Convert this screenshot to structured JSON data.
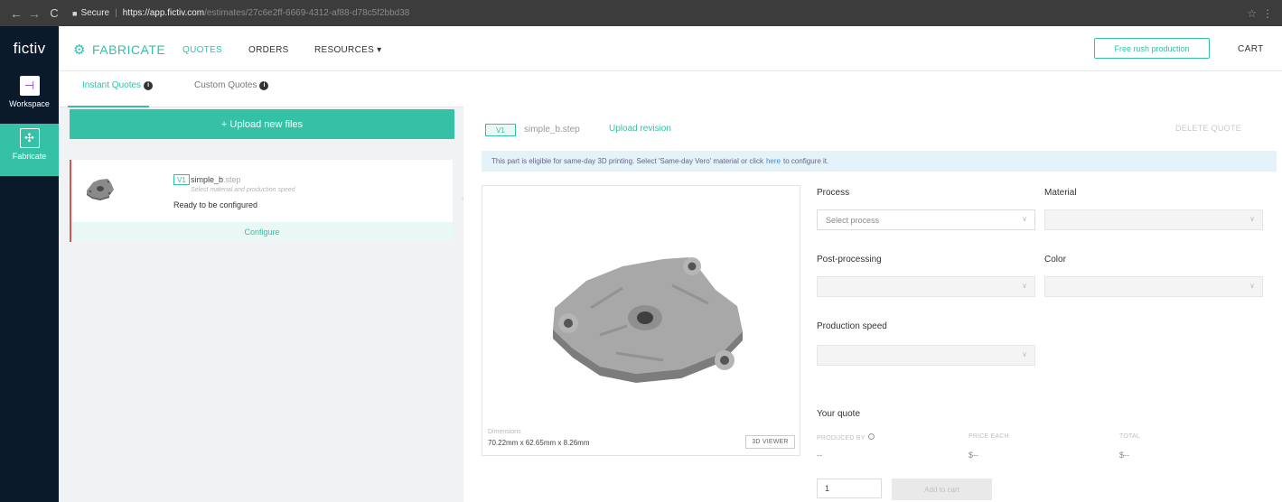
{
  "browser": {
    "secure_label": "Secure",
    "url_host": "https://app.fictiv.com",
    "url_path": "/estimates/27c6e2ff-6669-4312-af88-d78c5f2bbd38"
  },
  "sidebar": {
    "brand": "fictiv",
    "items": [
      {
        "label": "Workspace",
        "icon": "workspace-icon"
      },
      {
        "label": "Fabricate",
        "icon": "fabricate-icon"
      }
    ]
  },
  "topnav": {
    "logo_text": "FABRICATE",
    "links": [
      "QUOTES",
      "ORDERS",
      "RESOURCES ▾"
    ],
    "rush_button": "Free rush production",
    "cart": "CART"
  },
  "subtabs": [
    "Instant Quotes",
    "Custom Quotes"
  ],
  "upload_button": "+ Upload new files",
  "file_card": {
    "version": "V1",
    "filename": "simple_b",
    "ext": ".step",
    "hint": "Select material and production speed",
    "status": "Ready to be configured",
    "configure": "Configure"
  },
  "main": {
    "version": "V1",
    "filename": "simple_b.step",
    "upload_revision": "Upload revision",
    "delete_quote": "DELETE QUOTE",
    "notice_before": "This part is eligible for same-day 3D printing. Select 'Same-day Vero' material or click",
    "notice_link": "here",
    "notice_after": "to configure it.",
    "dimensions_label": "Dimensions",
    "dimensions_value": "70.22mm x 62.65mm x 8.26mm",
    "viewer_button": "3D VIEWER"
  },
  "form": {
    "process_label": "Process",
    "process_placeholder": "Select process",
    "material_label": "Material",
    "post_label": "Post-processing",
    "color_label": "Color",
    "speed_label": "Production speed"
  },
  "quote": {
    "title": "Your quote",
    "produced_by_label": "PRODUCED BY",
    "produced_by_value": "--",
    "price_each_label": "PRICE EACH",
    "price_each_value": "$--",
    "total_label": "TOTAL",
    "total_value": "$--",
    "quantity": "1",
    "add_to_cart": "Add to cart"
  },
  "colors": {
    "accent": "#35c1a5",
    "sidebar_bg": "#0b1a2b",
    "error_border": "#d9534f",
    "notice_bg": "#e4f2fa"
  }
}
